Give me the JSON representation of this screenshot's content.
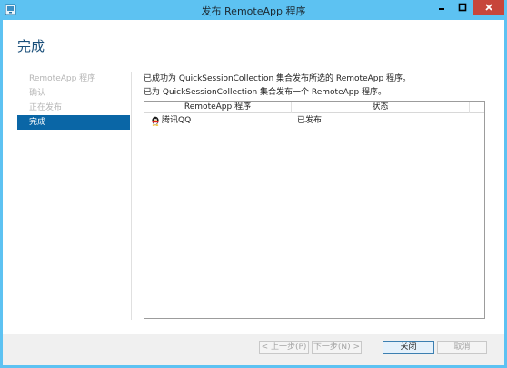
{
  "window": {
    "title": "发布 RemoteApp 程序",
    "icons": {
      "app": "remoteapp-icon",
      "minimize": "minimize-icon",
      "maximize": "maximize-icon",
      "close": "close-icon"
    }
  },
  "page": {
    "title": "完成"
  },
  "steps": [
    {
      "label": "RemoteApp 程序",
      "state": "disabled"
    },
    {
      "label": "确认",
      "state": "disabled"
    },
    {
      "label": "正在发布",
      "state": "disabled"
    },
    {
      "label": "完成",
      "state": "active"
    }
  ],
  "messages": {
    "line1": "已成功为 QuickSessionCollection 集合发布所选的 RemoteApp 程序。",
    "line2": "已为 QuickSessionCollection 集合发布一个 RemoteApp 程序。"
  },
  "table": {
    "columns": [
      "RemoteApp 程序",
      "状态"
    ],
    "rows": [
      {
        "program": "腾讯QQ",
        "status": "已发布",
        "icon": "qq-penguin-icon"
      }
    ]
  },
  "buttons": {
    "prev": "< 上一步(P)",
    "next": "下一步(N) >",
    "close": "关闭",
    "cancel": "取消"
  },
  "colors": {
    "titlebar": "#5dc2f2",
    "close_button": "#c7463b",
    "accent": "#0a66a6",
    "heading": "#1a4f7a"
  }
}
